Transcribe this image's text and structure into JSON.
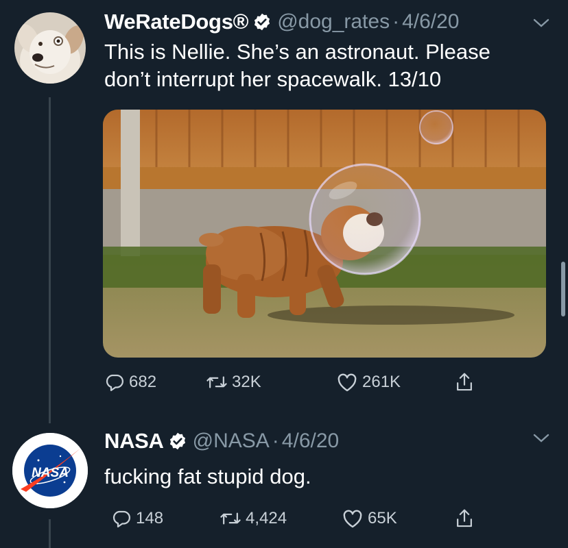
{
  "tweets": [
    {
      "display_name": "WeRateDogs®",
      "handle": "@dog_rates",
      "separator": "·",
      "date": "4/6/20",
      "text_line1": "This is Nellie. She’s an astronaut. Please",
      "text_line2": "don’t interrupt her spacewalk. 13/10",
      "replies": "682",
      "retweets": "32K",
      "likes": "261K"
    },
    {
      "display_name": "NASA",
      "handle": "@NASA",
      "separator": "·",
      "date": "4/6/20",
      "text": "fucking fat stupid dog.",
      "replies": "148",
      "retweets": "4,424",
      "likes": "65K"
    }
  ],
  "icons": {
    "verified": "verified-badge-icon",
    "reply": "reply-icon",
    "retweet": "retweet-icon",
    "like": "heart-icon",
    "share": "share-icon",
    "more": "chevron-down-icon"
  },
  "avatar_text": {
    "nasa": "NASA"
  },
  "colors": {
    "background": "#15202b",
    "secondary_text": "#8899a6",
    "primary_text": "#ffffff",
    "divider": "#38444d",
    "nasa_blue": "#0b3d91",
    "nasa_red": "#fc3d21"
  }
}
